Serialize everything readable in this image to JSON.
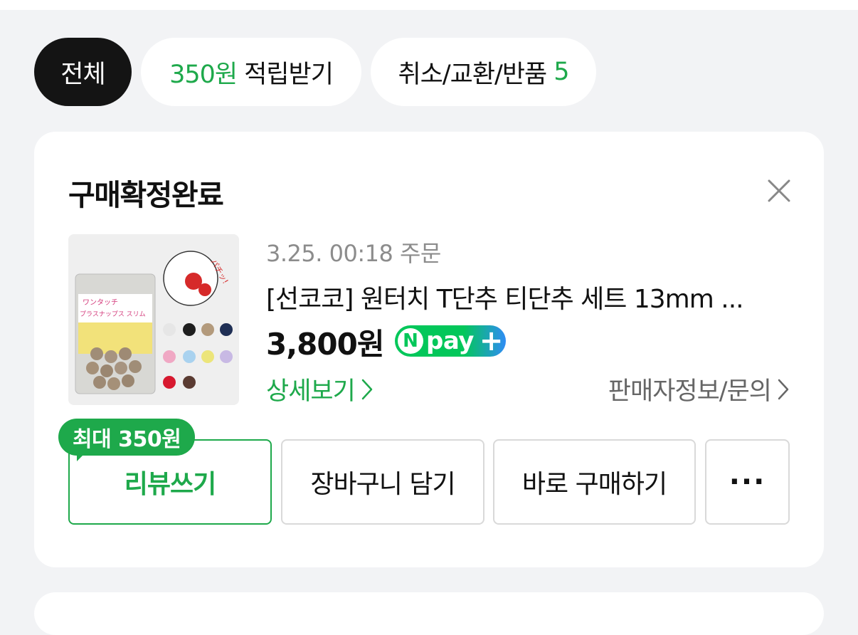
{
  "filters": {
    "all": "전체",
    "points_amount": "350원",
    "points_label": "적립받기",
    "cancel_label": "취소/교환/반품",
    "cancel_count": "5"
  },
  "order": {
    "status": "구매확정완료",
    "date": "3.25. 00:18 주문",
    "product_name": "[선코코] 원터치 T단추 티단추 세트 13mm ...",
    "price": "3,800원",
    "npay": {
      "n": "N",
      "pay": "pay",
      "plus": "+"
    },
    "detail_link": "상세보기",
    "seller_link": "판매자정보/문의",
    "thumbnail_text": {
      "brand": "ワンタッチ",
      "name": "プラスナップス スリム",
      "sound": "パチッ!"
    }
  },
  "actions": {
    "review_badge": "최대 350원",
    "review": "리뷰쓰기",
    "cart": "장바구니 담기",
    "buy": "바로 구매하기",
    "more": "···"
  },
  "colors": {
    "accent_green": "#1ea94b",
    "npay_green": "#03c75a",
    "npay_blue": "#2f8cf5",
    "background": "#f2f3f5"
  },
  "icons": [
    "close-icon",
    "chevron-right-icon",
    "npay-logo"
  ]
}
